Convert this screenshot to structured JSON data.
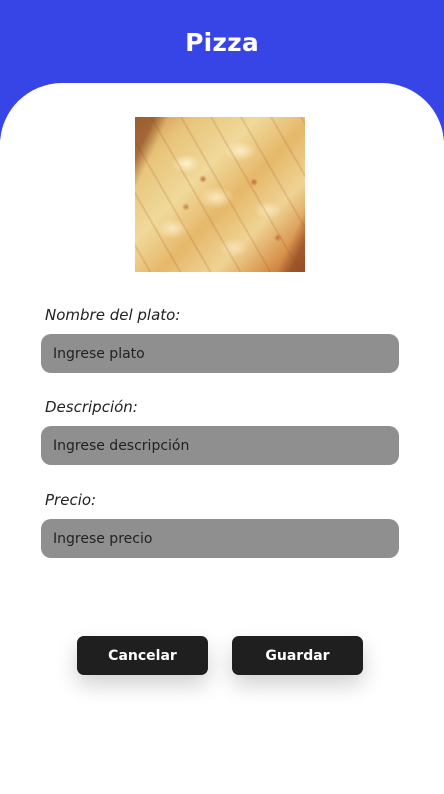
{
  "header": {
    "title": "Pizza"
  },
  "dish_image": {
    "alt": "pizza"
  },
  "form": {
    "name": {
      "label": "Nombre del plato:",
      "placeholder": "Ingrese plato",
      "value": ""
    },
    "description": {
      "label": "Descripción:",
      "placeholder": "Ingrese descripción",
      "value": ""
    },
    "price": {
      "label": "Precio:",
      "placeholder": "Ingrese precio",
      "value": ""
    }
  },
  "actions": {
    "cancel_label": "Cancelar",
    "save_label": "Guardar"
  },
  "colors": {
    "header_bg": "#3845e6",
    "input_bg": "#8f8f8f",
    "button_bg": "#1f1f1f"
  }
}
